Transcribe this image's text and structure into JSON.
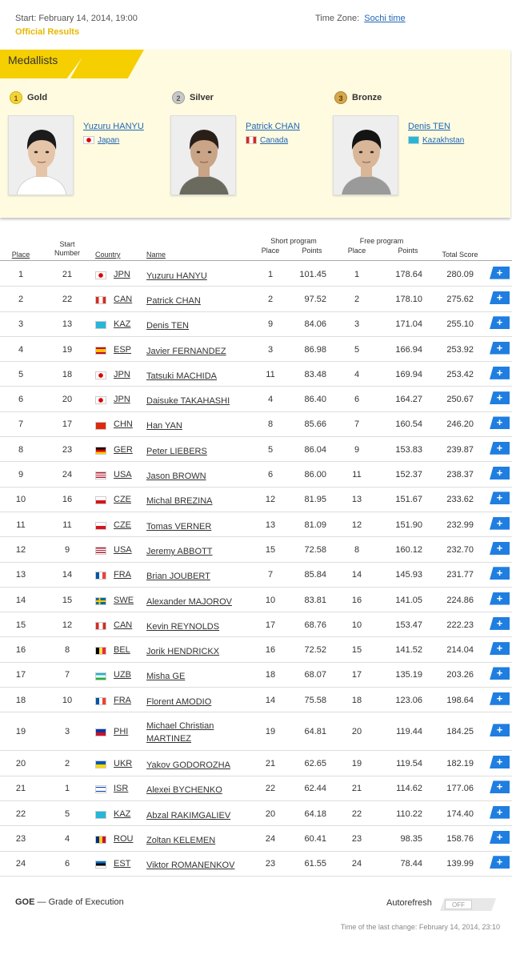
{
  "header": {
    "start": "Start: February 14, 2014, 19:00",
    "official": "Official Results",
    "timezone_label": "Time Zone:",
    "timezone_link": "Sochi time"
  },
  "medallists": {
    "title": "Medallists",
    "entries": [
      {
        "medal": "Gold",
        "num": "1",
        "name": "Yuzuru HANYU",
        "country": "Japan",
        "flag": "jpn"
      },
      {
        "medal": "Silver",
        "num": "2",
        "name": "Patrick CHAN",
        "country": "Canada",
        "flag": "can"
      },
      {
        "medal": "Bronze",
        "num": "3",
        "name": "Denis TEN",
        "country": "Kazakhstan",
        "flag": "kaz"
      }
    ]
  },
  "table": {
    "headers": {
      "place": "Place",
      "start_number": "Start Number",
      "country": "Country",
      "name": "Name",
      "short_program": "Short program",
      "free_program": "Free program",
      "sp_place": "Place",
      "sp_points": "Points",
      "fp_place": "Place",
      "fp_points": "Points",
      "total": "Total Score"
    },
    "rows": [
      {
        "place": "1",
        "start": "21",
        "code": "JPN",
        "name": "Yuzuru HANYU",
        "sp_place": "1",
        "sp_points": "101.45",
        "fp_place": "1",
        "fp_points": "178.64",
        "total": "280.09"
      },
      {
        "place": "2",
        "start": "22",
        "code": "CAN",
        "name": "Patrick CHAN",
        "sp_place": "2",
        "sp_points": "97.52",
        "fp_place": "2",
        "fp_points": "178.10",
        "total": "275.62"
      },
      {
        "place": "3",
        "start": "13",
        "code": "KAZ",
        "name": "Denis TEN",
        "sp_place": "9",
        "sp_points": "84.06",
        "fp_place": "3",
        "fp_points": "171.04",
        "total": "255.10"
      },
      {
        "place": "4",
        "start": "19",
        "code": "ESP",
        "name": "Javier FERNANDEZ",
        "sp_place": "3",
        "sp_points": "86.98",
        "fp_place": "5",
        "fp_points": "166.94",
        "total": "253.92"
      },
      {
        "place": "5",
        "start": "18",
        "code": "JPN",
        "name": "Tatsuki MACHIDA",
        "sp_place": "11",
        "sp_points": "83.48",
        "fp_place": "4",
        "fp_points": "169.94",
        "total": "253.42"
      },
      {
        "place": "6",
        "start": "20",
        "code": "JPN",
        "name": "Daisuke TAKAHASHI",
        "sp_place": "4",
        "sp_points": "86.40",
        "fp_place": "6",
        "fp_points": "164.27",
        "total": "250.67"
      },
      {
        "place": "7",
        "start": "17",
        "code": "CHN",
        "name": "Han YAN",
        "sp_place": "8",
        "sp_points": "85.66",
        "fp_place": "7",
        "fp_points": "160.54",
        "total": "246.20"
      },
      {
        "place": "8",
        "start": "23",
        "code": "GER",
        "name": "Peter LIEBERS",
        "sp_place": "5",
        "sp_points": "86.04",
        "fp_place": "9",
        "fp_points": "153.83",
        "total": "239.87"
      },
      {
        "place": "9",
        "start": "24",
        "code": "USA",
        "name": "Jason BROWN",
        "sp_place": "6",
        "sp_points": "86.00",
        "fp_place": "11",
        "fp_points": "152.37",
        "total": "238.37"
      },
      {
        "place": "10",
        "start": "16",
        "code": "CZE",
        "name": "Michal BREZINA",
        "sp_place": "12",
        "sp_points": "81.95",
        "fp_place": "13",
        "fp_points": "151.67",
        "total": "233.62"
      },
      {
        "place": "11",
        "start": "11",
        "code": "CZE",
        "name": "Tomas VERNER",
        "sp_place": "13",
        "sp_points": "81.09",
        "fp_place": "12",
        "fp_points": "151.90",
        "total": "232.99"
      },
      {
        "place": "12",
        "start": "9",
        "code": "USA",
        "name": "Jeremy ABBOTT",
        "sp_place": "15",
        "sp_points": "72.58",
        "fp_place": "8",
        "fp_points": "160.12",
        "total": "232.70"
      },
      {
        "place": "13",
        "start": "14",
        "code": "FRA",
        "name": "Brian JOUBERT",
        "sp_place": "7",
        "sp_points": "85.84",
        "fp_place": "14",
        "fp_points": "145.93",
        "total": "231.77"
      },
      {
        "place": "14",
        "start": "15",
        "code": "SWE",
        "name": "Alexander MAJOROV",
        "sp_place": "10",
        "sp_points": "83.81",
        "fp_place": "16",
        "fp_points": "141.05",
        "total": "224.86"
      },
      {
        "place": "15",
        "start": "12",
        "code": "CAN",
        "name": "Kevin REYNOLDS",
        "sp_place": "17",
        "sp_points": "68.76",
        "fp_place": "10",
        "fp_points": "153.47",
        "total": "222.23"
      },
      {
        "place": "16",
        "start": "8",
        "code": "BEL",
        "name": "Jorik HENDRICKX",
        "sp_place": "16",
        "sp_points": "72.52",
        "fp_place": "15",
        "fp_points": "141.52",
        "total": "214.04"
      },
      {
        "place": "17",
        "start": "7",
        "code": "UZB",
        "name": "Misha GE",
        "sp_place": "18",
        "sp_points": "68.07",
        "fp_place": "17",
        "fp_points": "135.19",
        "total": "203.26"
      },
      {
        "place": "18",
        "start": "10",
        "code": "FRA",
        "name": "Florent AMODIO",
        "sp_place": "14",
        "sp_points": "75.58",
        "fp_place": "18",
        "fp_points": "123.06",
        "total": "198.64"
      },
      {
        "place": "19",
        "start": "3",
        "code": "PHI",
        "name": "Michael Christian MARTINEZ",
        "sp_place": "19",
        "sp_points": "64.81",
        "fp_place": "20",
        "fp_points": "119.44",
        "total": "184.25"
      },
      {
        "place": "20",
        "start": "2",
        "code": "UKR",
        "name": "Yakov GODOROZHA",
        "sp_place": "21",
        "sp_points": "62.65",
        "fp_place": "19",
        "fp_points": "119.54",
        "total": "182.19"
      },
      {
        "place": "21",
        "start": "1",
        "code": "ISR",
        "name": "Alexei BYCHENKO",
        "sp_place": "22",
        "sp_points": "62.44",
        "fp_place": "21",
        "fp_points": "114.62",
        "total": "177.06"
      },
      {
        "place": "22",
        "start": "5",
        "code": "KAZ",
        "name": "Abzal RAKIMGALIEV",
        "sp_place": "20",
        "sp_points": "64.18",
        "fp_place": "22",
        "fp_points": "110.22",
        "total": "174.40"
      },
      {
        "place": "23",
        "start": "4",
        "code": "ROU",
        "name": "Zoltan KELEMEN",
        "sp_place": "24",
        "sp_points": "60.41",
        "fp_place": "23",
        "fp_points": "98.35",
        "total": "158.76"
      },
      {
        "place": "24",
        "start": "6",
        "code": "EST",
        "name": "Viktor ROMANENKOV",
        "sp_place": "23",
        "sp_points": "61.55",
        "fp_place": "24",
        "fp_points": "78.44",
        "total": "139.99"
      }
    ],
    "expand_label": "+"
  },
  "footer": {
    "goe_abbr": "GOE",
    "goe_text": " — Grade of Execution",
    "autorefresh": "Autorefresh",
    "toggle": "OFF",
    "last_change": "Time of the last change: February 14, 2014, 23:10"
  },
  "colors": {
    "accent_yellow": "#f5cf00",
    "panel_bg": "#fffbe0",
    "link_blue": "#2066b5",
    "expand_blue": "#1f7ee0"
  }
}
